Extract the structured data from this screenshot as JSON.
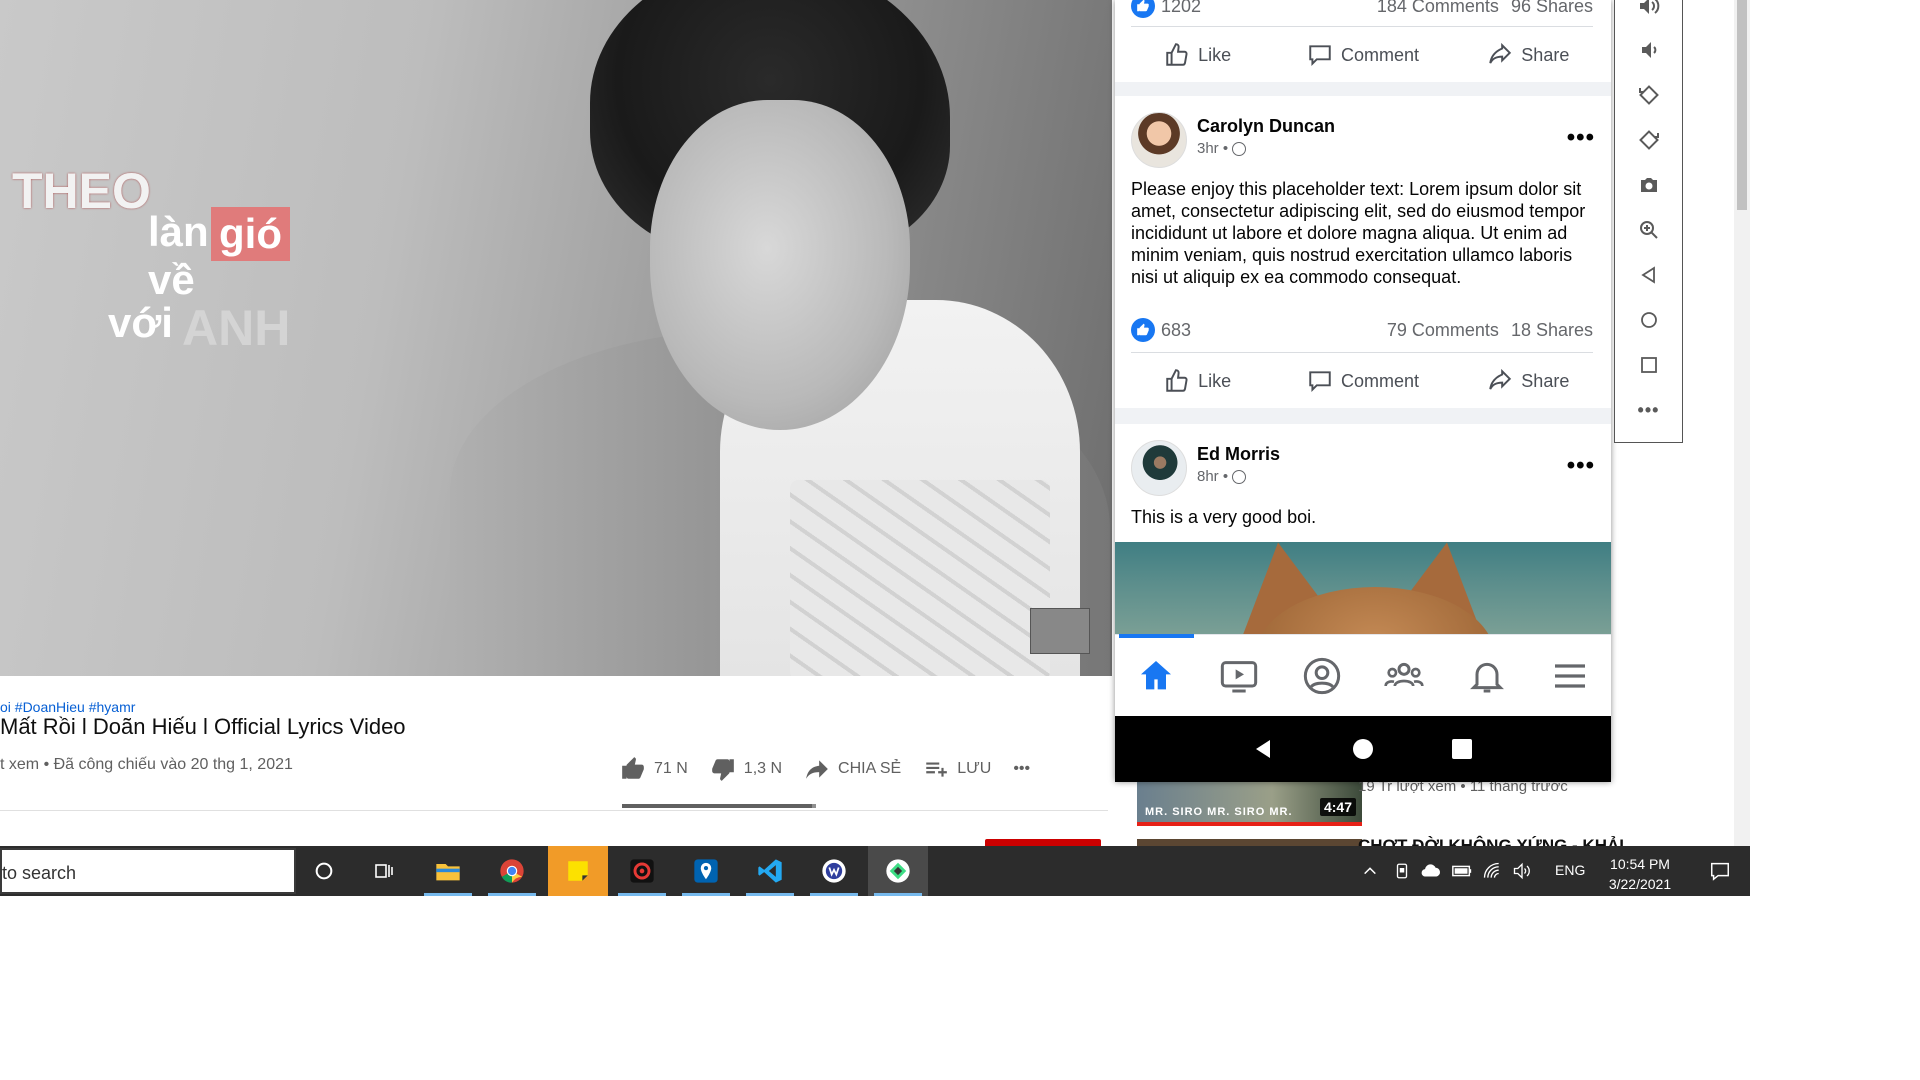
{
  "video": {
    "lyrics": {
      "theo": "THEO",
      "lan": "làn",
      "gio": "gió",
      "ve": "về",
      "voi": "với",
      "anh": "ANH"
    }
  },
  "youtube": {
    "tags": "oi #DoanHieu #hyamr",
    "title": "Mất Rồi l Doãn Hiếu l Official Lyrics Video",
    "views": "t xem • Đã công chiếu vào 20 thg 1, 2021",
    "likes": "71 N",
    "dislikes": "1,3 N",
    "share": "CHIA SẺ",
    "save": "LƯU",
    "more": "•••",
    "like_ratio": 0.98,
    "sidebar": {
      "thumb_label": "MR. SIRO   MR. SIRO   MR.",
      "duration": "4:47",
      "meta": "19 Tr lượt xem • 11 tháng trước",
      "next_title": "CHỢT ĐỜI KHÔNG XỨNG - KHẢI"
    }
  },
  "facebook": {
    "top_post": {
      "likes": "1202",
      "comments": "184 Comments",
      "shares": "96 Shares"
    },
    "actions": {
      "like": "Like",
      "comment": "Comment",
      "share": "Share"
    },
    "post_carolyn": {
      "author": "Carolyn Duncan",
      "time": "3hr •",
      "text": "Please enjoy this placeholder text: Lorem ipsum dolor sit amet, consectetur adipiscing elit, sed do eiusmod tempor incididunt ut labore et dolore magna aliqua. Ut enim ad minim veniam, quis nostrud exercitation ullamco laboris nisi ut aliquip ex ea commodo consequat.",
      "likes": "683",
      "comments": "79 Comments",
      "shares": "18 Shares"
    },
    "post_ed": {
      "author": "Ed Morris",
      "time": "8hr •",
      "text": "This is a very good boi."
    },
    "more": "•••"
  },
  "emulator": {
    "more": "•••"
  },
  "taskbar": {
    "search_placeholder": "to search",
    "language": "ENG",
    "time": "10:54 PM",
    "date": "3/22/2021"
  },
  "colors": {
    "facebook_blue": "#1877f2",
    "youtube_red": "#cc0000",
    "taskbar": "#2c2c2c"
  }
}
